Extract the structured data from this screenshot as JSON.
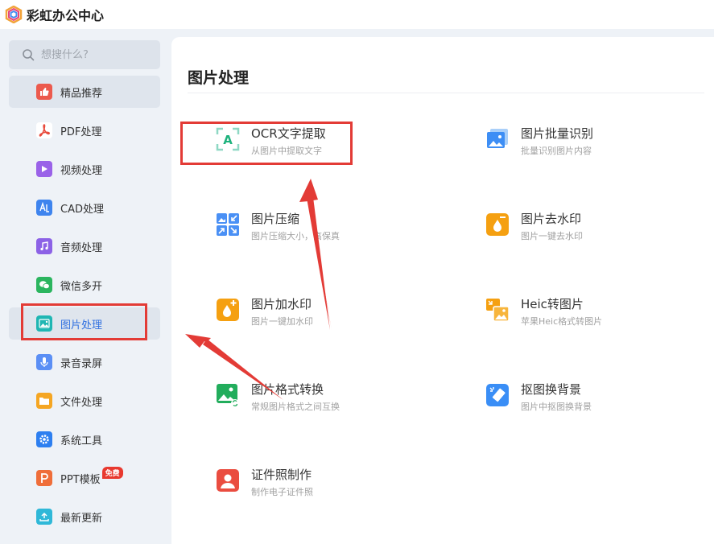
{
  "app": {
    "title": "彩虹办公中心"
  },
  "search": {
    "placeholder": "想搜什么?"
  },
  "sidebar": {
    "items": [
      {
        "label": "精品推荐",
        "icon": "thumbs-up-icon",
        "color": "#ec5a4d"
      },
      {
        "label": "PDF处理",
        "icon": "pdf-icon",
        "color": "#ffffff"
      },
      {
        "label": "视频处理",
        "icon": "video-play-icon",
        "color": "#9a62e8"
      },
      {
        "label": "CAD处理",
        "icon": "cad-icon",
        "color": "#3e84ee"
      },
      {
        "label": "音频处理",
        "icon": "music-note-icon",
        "color": "#8c62e6"
      },
      {
        "label": "微信多开",
        "icon": "wechat-icon",
        "color": "#2bb55f"
      },
      {
        "label": "图片处理",
        "icon": "image-icon",
        "color": "#1fb6b3"
      },
      {
        "label": "录音录屏",
        "icon": "microphone-icon",
        "color": "#5b8ff5"
      },
      {
        "label": "文件处理",
        "icon": "folder-icon",
        "color": "#f5a623"
      },
      {
        "label": "系统工具",
        "icon": "gear-icon",
        "color": "#2d7ff0"
      },
      {
        "label": "PPT模板",
        "icon": "ppt-icon",
        "color": "#ef6e3a",
        "badge": "免费"
      },
      {
        "label": "最新更新",
        "icon": "upload-icon",
        "color": "#2fb8d8"
      }
    ],
    "active_index": 6
  },
  "main": {
    "title": "图片处理",
    "tools": [
      {
        "name": "OCR文字提取",
        "desc": "从图片中提取文字",
        "icon": "ocr-text-icon"
      },
      {
        "name": "图片批量识别",
        "desc": "批量识别图片内容",
        "icon": "batch-image-icon"
      },
      {
        "name": "图片压缩",
        "desc": "图片压缩大小，高保真",
        "icon": "compress-icon"
      },
      {
        "name": "图片去水印",
        "desc": "图片一键去水印",
        "icon": "remove-watermark-icon"
      },
      {
        "name": "图片加水印",
        "desc": "图片一键加水印",
        "icon": "add-watermark-icon"
      },
      {
        "name": "Heic转图片",
        "desc": "苹果Heic格式转图片",
        "icon": "heic-convert-icon"
      },
      {
        "name": "图片格式转换",
        "desc": "常规图片格式之间互换",
        "icon": "format-convert-icon"
      },
      {
        "name": "抠图换背景",
        "desc": "图片中抠图换背景",
        "icon": "cutout-icon"
      },
      {
        "name": "证件照制作",
        "desc": "制作电子证件照",
        "icon": "id-photo-icon"
      }
    ]
  },
  "annotations": {
    "highlight_color": "#e33b36"
  }
}
